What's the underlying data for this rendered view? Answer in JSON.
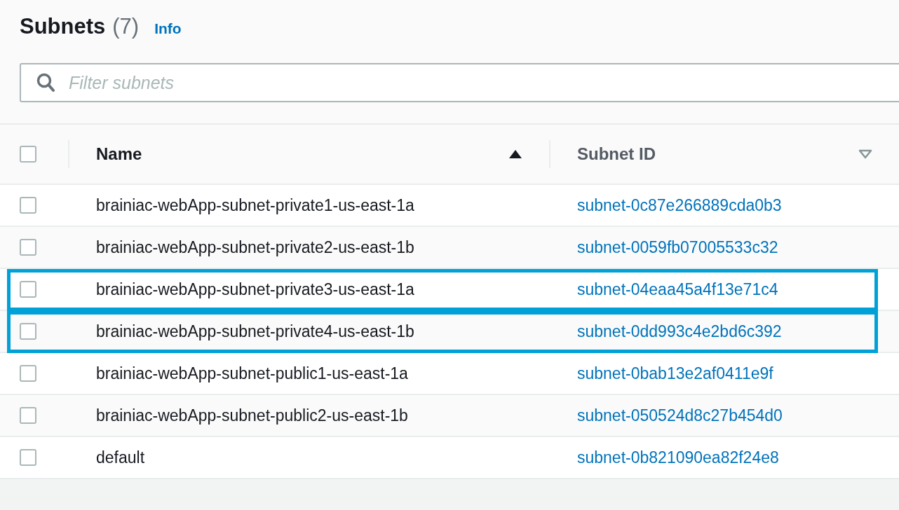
{
  "header": {
    "title": "Subnets",
    "count": "(7)",
    "info_link": "Info"
  },
  "filter": {
    "placeholder": "Filter subnets"
  },
  "table": {
    "select_all": {
      "checked": false
    },
    "columns": [
      {
        "label": "Name",
        "sorted": true
      },
      {
        "label": "Subnet ID",
        "sorted": false
      }
    ],
    "rows": [
      {
        "name": "brainiac-webApp-subnet-private1-us-east-1a",
        "subnet_id": "subnet-0c87e266889cda0b3",
        "checked": false,
        "highlighted": false
      },
      {
        "name": "brainiac-webApp-subnet-private2-us-east-1b",
        "subnet_id": "subnet-0059fb07005533c32",
        "checked": false,
        "highlighted": false
      },
      {
        "name": "brainiac-webApp-subnet-private3-us-east-1a",
        "subnet_id": "subnet-04eaa45a4f13e71c4",
        "checked": false,
        "highlighted": true
      },
      {
        "name": "brainiac-webApp-subnet-private4-us-east-1b",
        "subnet_id": "subnet-0dd993c4e2bd6c392",
        "checked": false,
        "highlighted": true
      },
      {
        "name": "brainiac-webApp-subnet-public1-us-east-1a",
        "subnet_id": "subnet-0bab13e2af0411e9f",
        "checked": false,
        "highlighted": false
      },
      {
        "name": "brainiac-webApp-subnet-public2-us-east-1b",
        "subnet_id": "subnet-050524d8c27b454d0",
        "checked": false,
        "highlighted": false
      },
      {
        "name": "default",
        "subnet_id": "subnet-0b821090ea82f24e8",
        "checked": false,
        "highlighted": false
      }
    ]
  }
}
